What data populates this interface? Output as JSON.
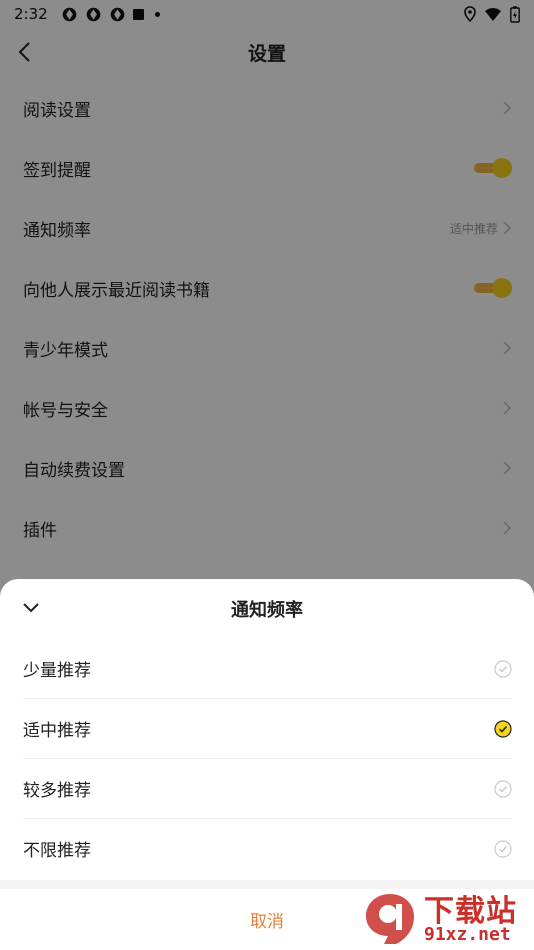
{
  "status_bar": {
    "time": "2:32"
  },
  "nav": {
    "title": "设置"
  },
  "settings": {
    "items": [
      {
        "label": "阅读设置",
        "type": "chevron"
      },
      {
        "label": "签到提醒",
        "type": "toggle",
        "on": true
      },
      {
        "label": "通知频率",
        "type": "chevron",
        "value": "适中推荐"
      },
      {
        "label": "向他人展示最近阅读书籍",
        "type": "toggle",
        "on": true
      },
      {
        "label": "青少年模式",
        "type": "chevron"
      },
      {
        "label": "帐号与安全",
        "type": "chevron"
      },
      {
        "label": "自动续费设置",
        "type": "chevron"
      },
      {
        "label": "插件",
        "type": "chevron"
      }
    ]
  },
  "sheet": {
    "title": "通知频率",
    "options": [
      {
        "label": "少量推荐",
        "selected": false
      },
      {
        "label": "适中推荐",
        "selected": true
      },
      {
        "label": "较多推荐",
        "selected": false
      },
      {
        "label": "不限推荐",
        "selected": false
      }
    ],
    "cancel_label": "取消"
  },
  "watermark": {
    "main": "下载站",
    "sub": "91xz.net"
  },
  "colors": {
    "toggle_on": "#f7d21e",
    "accent": "#e0803a",
    "selected_radio": "#f7d21e",
    "watermark": "#c9302c"
  }
}
